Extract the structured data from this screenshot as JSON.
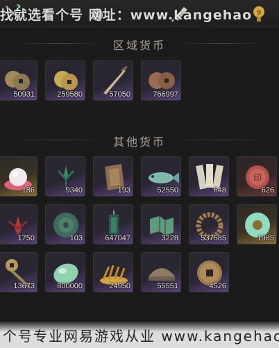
{
  "top_watermark": "找就选看个号   网址：www.kangehao",
  "regional_title": "区域货币",
  "other_title": "其他货币",
  "regional_items": [
    {
      "name": "coin-stack-icon",
      "qty": "50931",
      "rarity": "purple"
    },
    {
      "name": "gold-coin-stack-icon",
      "qty": "259580",
      "rarity": "purple"
    },
    {
      "name": "dagger-token-icon",
      "qty": "57050",
      "rarity": "purple"
    },
    {
      "name": "copper-coin-stack-icon",
      "qty": "766997",
      "rarity": "purple"
    }
  ],
  "other_items": [
    {
      "name": "pearl-icon",
      "qty": "186",
      "rarity": "gold"
    },
    {
      "name": "spider-lily-icon",
      "qty": "9340",
      "rarity": "purple"
    },
    {
      "name": "bronze-tablet-icon",
      "qty": "193",
      "rarity": "purple"
    },
    {
      "name": "jade-fish-icon",
      "qty": "52550",
      "rarity": "purple"
    },
    {
      "name": "paper-slips-icon",
      "qty": "648",
      "rarity": "purple"
    },
    {
      "name": "red-seal-icon",
      "qty": "626",
      "rarity": "red"
    },
    {
      "name": "red-flower-icon",
      "qty": "1750",
      "rarity": "purple"
    },
    {
      "name": "green-disc-icon",
      "qty": "103",
      "rarity": "purple"
    },
    {
      "name": "jade-pendant-icon",
      "qty": "647047",
      "rarity": "purple"
    },
    {
      "name": "green-map-icon",
      "qty": "3228",
      "rarity": "purple"
    },
    {
      "name": "bead-bracelet-icon",
      "qty": "537585",
      "rarity": "purple"
    },
    {
      "name": "jade-ring-icon",
      "qty": "1985",
      "rarity": "gold"
    },
    {
      "name": "coin-string-icon",
      "qty": "13673",
      "rarity": "purple"
    },
    {
      "name": "jade-stone-icon",
      "qty": "800000",
      "rarity": "purple"
    },
    {
      "name": "golden-grain-icon",
      "qty": "24950",
      "rarity": "purple"
    },
    {
      "name": "bronze-bowl-icon",
      "qty": "55551",
      "rarity": "purple"
    },
    {
      "name": "square-hole-coin-icon",
      "qty": "4526",
      "rarity": "purple"
    }
  ],
  "bottom_watermark": "个号专业网易游戏从业  www.kangehao"
}
